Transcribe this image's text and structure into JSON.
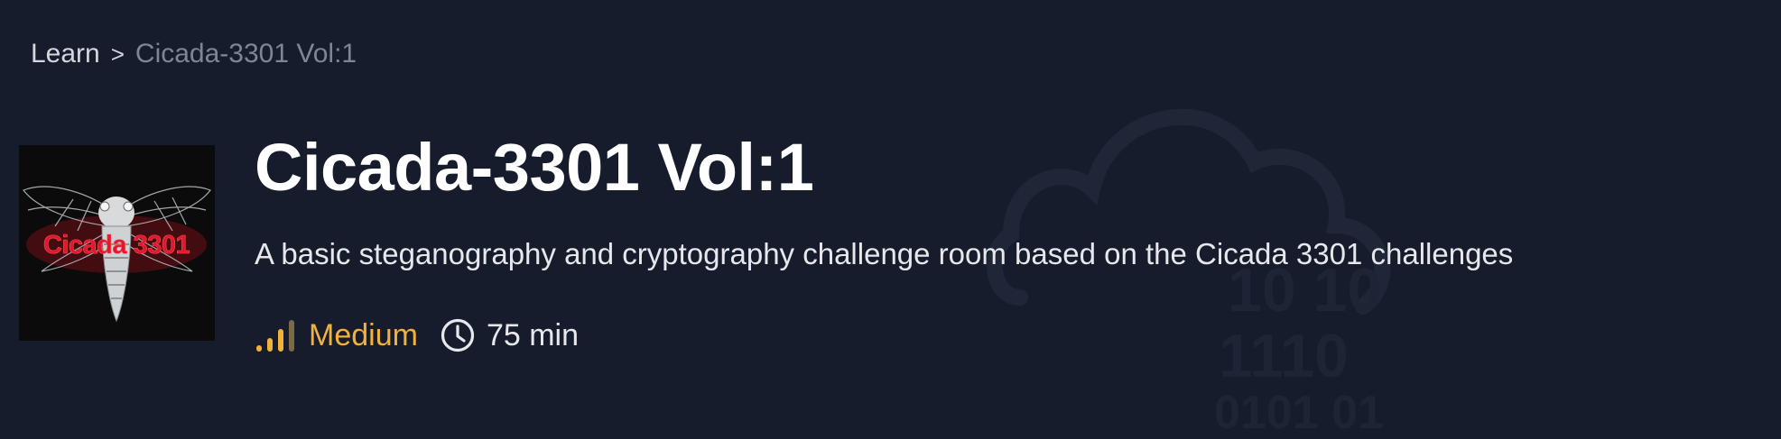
{
  "breadcrumb": {
    "home": "Learn",
    "separator": ">",
    "current": "Cicada-3301 Vol:1"
  },
  "room": {
    "title": "Cicada-3301 Vol:1",
    "description": "A basic steganography and cryptography challenge room based on the Cicada 3301 challenges",
    "thumbnail_text": "Cicada 3301",
    "difficulty": "Medium",
    "duration": "75 min"
  },
  "background_art": {
    "binary_lines": [
      "10  10",
      "1110",
      "0101  01"
    ]
  },
  "colors": {
    "background": "#161c2c",
    "difficulty_medium": "#f2b13a",
    "thumbnail_text": "#e0182b"
  },
  "icons": {
    "difficulty": "signal-bars-icon",
    "duration": "clock-icon"
  }
}
